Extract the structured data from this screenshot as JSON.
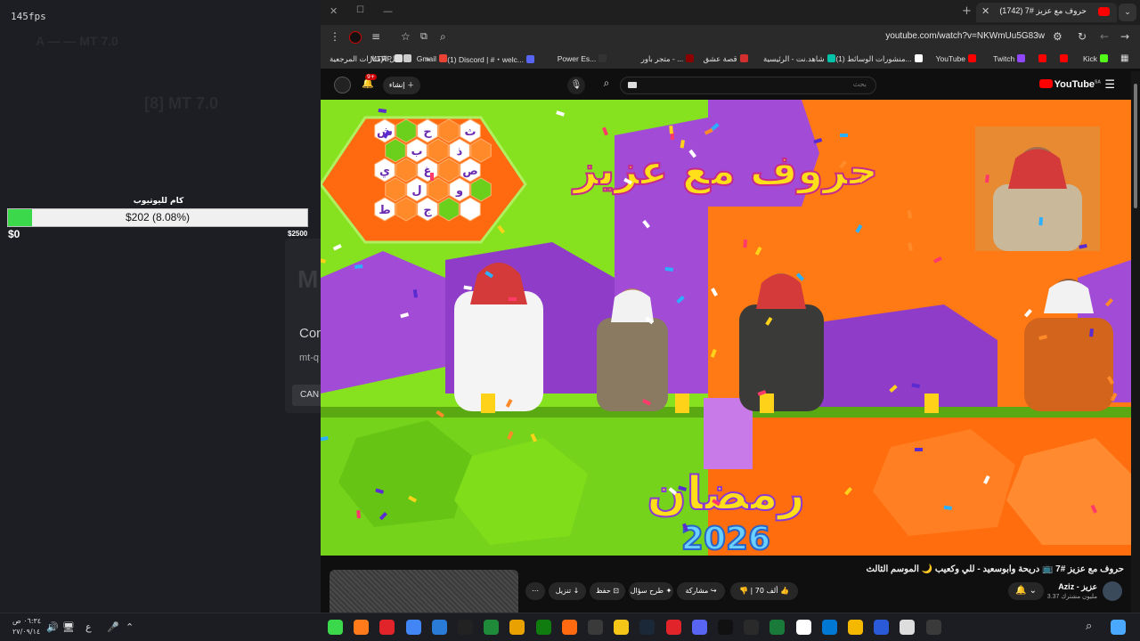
{
  "overlay": {
    "fps": "145fps",
    "goal_title": "كام لليوتيوب",
    "goal_text": "$202 (8.08%)",
    "goal_progress_percent": 8.08,
    "goal_min": "$0",
    "goal_max": "$2500",
    "dialog_logo": "M",
    "dialog_text": "Con",
    "dialog_sub": "mt-q",
    "dialog_cancel": "CAN"
  },
  "browser": {
    "tab_title": "(1742) حروف مع عزيز #7",
    "url": "youtube.com/watch?v=NKWmUu5G83w",
    "bookmarks": [
      {
        "label": "Kick",
        "color": "#53fc18"
      },
      {
        "label": "",
        "color": "#ff0000"
      },
      {
        "label": "",
        "color": "#ff0000"
      },
      {
        "label": "Twitch",
        "color": "#9146ff"
      },
      {
        "label": "YouTube",
        "color": "#ff0000"
      },
      {
        "label": "(1) منشورات الوسائط...",
        "color": "#ffffff"
      },
      {
        "label": "شاهد.نت - الرئيسية",
        "color": "#00c2a8"
      },
      {
        "label": "قصة عشق",
        "color": "#d32f2f"
      },
      {
        "label": "متجر باور - ...",
        "color": "#8b0000"
      },
      {
        "label": "Power Es...",
        "color": "#333333"
      },
      {
        "label": "(1) Discord | #・welc...",
        "color": "#5865f2"
      },
      {
        "label": "Gmail",
        "color": "#ea4335"
      },
      {
        "label": "MTRP",
        "color": "#dddddd"
      }
    ],
    "bookmarks_all": "كل الإشارات المرجعية"
  },
  "youtube": {
    "logo": "YouTube",
    "logo_country": "SA",
    "search_placeholder": "بحث",
    "create_label": "إنشاء",
    "notif_count": "9+",
    "video_title": "حروف مع عزيز #7 📺 دريحة وابوسعيد - للي وكعيب 🌙 الموسم الثالث",
    "channel_name": "Aziz - عزيز",
    "channel_subs": "3.37 مليون مشترك",
    "like_count": "70 ألف",
    "share_label": "مشاركة",
    "ask_label": "طرح سؤال",
    "save_label": "حفظ",
    "download_label": "تنزيل",
    "more_label": "⋯"
  },
  "video_scene": {
    "board_letters": [
      "ش",
      "ح",
      "ث",
      "ب",
      "ذ",
      "ي",
      "غ",
      "ص",
      "ل",
      "و",
      "ط",
      "ج"
    ],
    "banner_top": "حروف مع عزيز",
    "banner_bottom": "رمضان",
    "banner_year": "2026",
    "colors": {
      "green": "#86e21f",
      "orange": "#ff7a14",
      "purple": "#a24bd6",
      "yellow": "#ffd21a"
    }
  },
  "taskbar": {
    "time": "٠٦:٣٤ ص",
    "date": "٢٧/٠٩/١٤",
    "lang": "ع"
  }
}
